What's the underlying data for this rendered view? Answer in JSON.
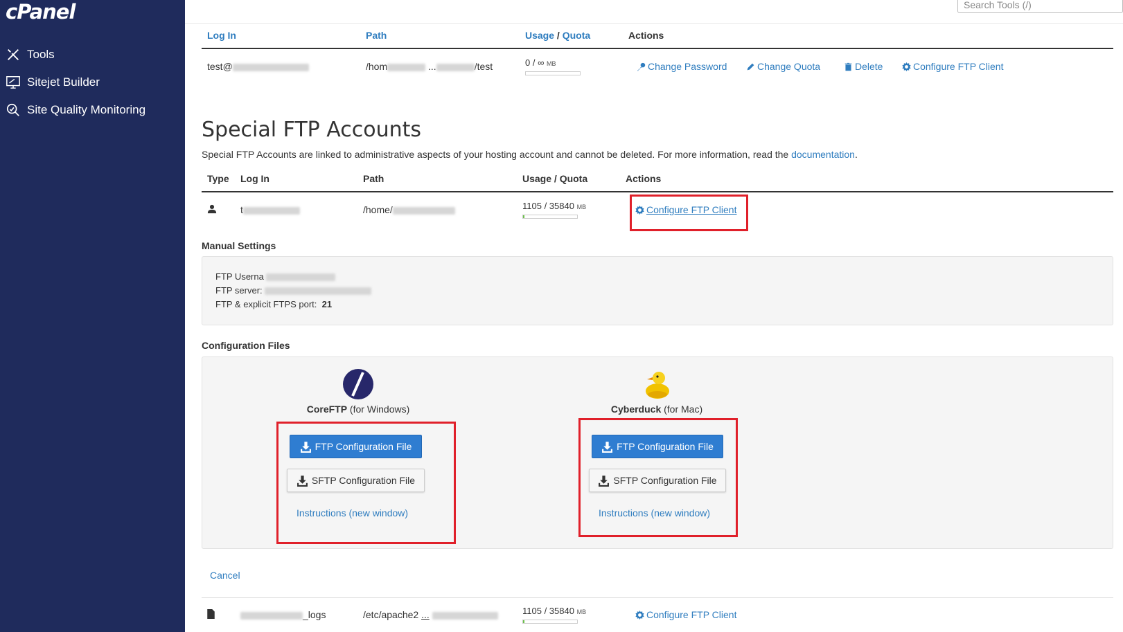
{
  "brand": {
    "logo": "cPanel"
  },
  "sidebar": {
    "items": [
      {
        "label": "Tools",
        "icon": "tools-icon"
      },
      {
        "label": "Sitejet Builder",
        "icon": "monitor-icon"
      },
      {
        "label": "Site Quality Monitoring",
        "icon": "magnifier-icon"
      }
    ]
  },
  "search": {
    "placeholder": "Search Tools (/)"
  },
  "ftp_table": {
    "headers": {
      "login": "Log In",
      "path": "Path",
      "usage": "Usage",
      "slash": " / ",
      "quota": "Quota",
      "actions": "Actions"
    },
    "row": {
      "login_prefix": "test@",
      "path_prefix": "/hom",
      "path_mid": "...",
      "path_suffix": "/test",
      "usage": "0 / ∞",
      "unit": "MB",
      "usage_fraction": 0,
      "actions": {
        "change_password": "Change Password",
        "change_quota": "Change Quota",
        "delete": "Delete",
        "configure": "Configure FTP Client"
      }
    }
  },
  "special": {
    "title": "Special FTP Accounts",
    "description": "Special FTP Accounts are linked to administrative aspects of your hosting account and cannot be deleted. For more information, read the ",
    "doc_link": "documentation",
    "desc_end": ".",
    "headers": {
      "type": "Type",
      "login": "Log In",
      "path": "Path",
      "usage": "Usage / Quota",
      "actions": "Actions"
    },
    "row1": {
      "login_prefix": "t",
      "path_prefix": "/home/",
      "usage": "1105 / 35840",
      "unit": "MB",
      "usage_fraction": 0.03,
      "action": "Configure FTP Client"
    },
    "manual": {
      "title": "Manual Settings",
      "username_label": "FTP Userna",
      "server_label": "FTP server:",
      "port_label": "FTP & explicit FTPS port:",
      "port_value": "21"
    },
    "config": {
      "title": "Configuration Files",
      "clients": [
        {
          "name": "CoreFTP",
          "platform": " (for Windows)",
          "ftp_btn": "FTP Configuration File",
          "sftp_btn": "SFTP Configuration File",
          "instructions": "Instructions (new window)"
        },
        {
          "name": "Cyberduck",
          "platform": " (for Mac)",
          "ftp_btn": "FTP Configuration File",
          "sftp_btn": "SFTP Configuration File",
          "instructions": "Instructions (new window)"
        }
      ]
    },
    "cancel": "Cancel",
    "row2": {
      "login_suffix": "_logs",
      "path_prefix": "/etc/apache2",
      "path_mid": "...",
      "usage": "1105 / 35840",
      "unit": "MB",
      "usage_fraction": 0.03,
      "action": "Configure FTP Client"
    }
  },
  "colors": {
    "sidebar": "#1f2b5c",
    "link": "#2f7dbf",
    "primary_button": "#2f7dd1",
    "highlight": "#e0202a",
    "usage_fill": "#6cc04a"
  }
}
